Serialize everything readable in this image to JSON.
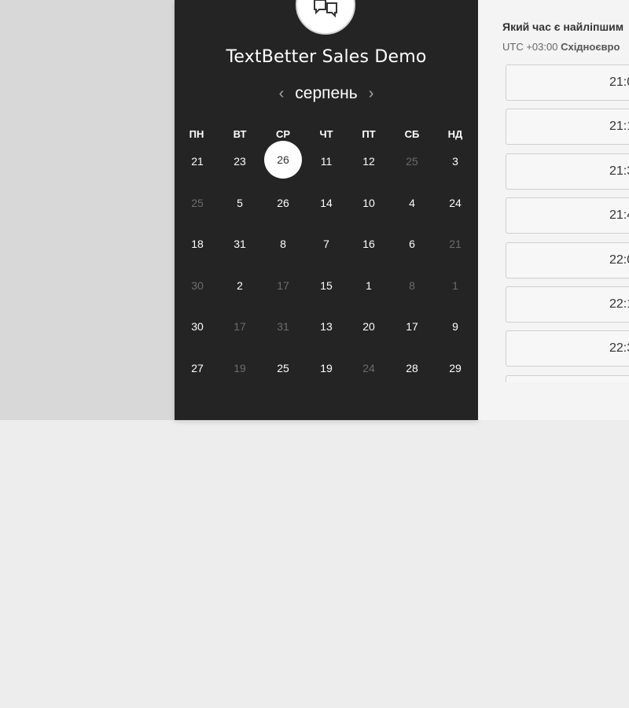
{
  "title": "TextBetter Sales Demo",
  "month_nav": {
    "prev": "‹",
    "month": "серпень",
    "next": "›"
  },
  "weekdays": [
    "ПН",
    "ВТ",
    "СР",
    "ЧТ",
    "ПТ",
    "СБ",
    "НД"
  ],
  "calendar": {
    "rows": [
      [
        {
          "t": "21",
          "m": false
        },
        {
          "t": "23",
          "m": false
        },
        {
          "t": "26",
          "m": false,
          "s": true
        },
        {
          "t": "11",
          "m": false
        },
        {
          "t": "12",
          "m": false
        },
        {
          "t": "25",
          "m": true
        },
        {
          "t": "3",
          "m": false
        }
      ],
      [
        {
          "t": "25",
          "m": true
        },
        {
          "t": "5",
          "m": false
        },
        {
          "t": "26",
          "m": false
        },
        {
          "t": "14",
          "m": false
        },
        {
          "t": "10",
          "m": false
        },
        {
          "t": "4",
          "m": false
        },
        {
          "t": "24",
          "m": false
        }
      ],
      [
        {
          "t": "18",
          "m": false
        },
        {
          "t": "31",
          "m": false
        },
        {
          "t": "8",
          "m": false
        },
        {
          "t": "7",
          "m": false
        },
        {
          "t": "16",
          "m": false
        },
        {
          "t": "6",
          "m": false
        },
        {
          "t": "21",
          "m": true
        }
      ],
      [
        {
          "t": "30",
          "m": true
        },
        {
          "t": "2",
          "m": false
        },
        {
          "t": "17",
          "m": true
        },
        {
          "t": "15",
          "m": false
        },
        {
          "t": "1",
          "m": false
        },
        {
          "t": "8",
          "m": true
        },
        {
          "t": "1",
          "m": true
        }
      ],
      [
        {
          "t": "30",
          "m": false
        },
        {
          "t": "17",
          "m": true
        },
        {
          "t": "31",
          "m": true
        },
        {
          "t": "13",
          "m": false
        },
        {
          "t": "20",
          "m": false
        },
        {
          "t": "17",
          "m": false
        },
        {
          "t": "9",
          "m": false
        }
      ],
      [
        {
          "t": "27",
          "m": false
        },
        {
          "t": "19",
          "m": true
        },
        {
          "t": "25",
          "m": false
        },
        {
          "t": "19",
          "m": false
        },
        {
          "t": "24",
          "m": true
        },
        {
          "t": "28",
          "m": false
        },
        {
          "t": "29",
          "m": false
        }
      ]
    ]
  },
  "schedule": {
    "question": "Який час є найліпшим",
    "timezone_offset": "UTC +03:00",
    "timezone_name": "Східноєвро",
    "slots": [
      "21:0",
      "21:1",
      "21:3",
      "21:4",
      "22:0",
      "22:1",
      "22:3",
      ""
    ]
  }
}
